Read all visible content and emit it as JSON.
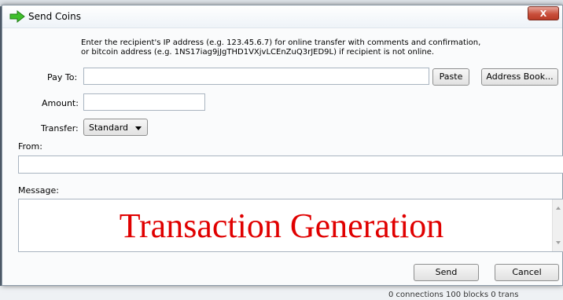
{
  "window": {
    "title": "Send Coins",
    "title_icon": "green-arrow-icon",
    "close_label": "X"
  },
  "instructions": {
    "line1": "Enter the recipient's IP address (e.g. 123.45.6.7) for online transfer with comments and confirmation,",
    "line2": "or bitcoin address (e.g. 1NS17iag9jJgTHD1VXjvLCEnZuQ3rJED9L) if recipient is not online."
  },
  "pay_to": {
    "label": "Pay To:",
    "value": "",
    "paste_label": "Paste",
    "address_book_label": "Address Book..."
  },
  "amount": {
    "label": "Amount:",
    "value": ""
  },
  "transfer": {
    "label": "Transfer:",
    "selected": "Standard"
  },
  "from": {
    "label": "From:",
    "value": ""
  },
  "message": {
    "label": "Message:",
    "value": ""
  },
  "actions": {
    "send_label": "Send",
    "cancel_label": "Cancel"
  },
  "overlay": {
    "caption": "Transaction Generation",
    "color": "#e00000"
  },
  "background": {
    "status_fragment": "0 connections    100 blocks    0 trans"
  }
}
